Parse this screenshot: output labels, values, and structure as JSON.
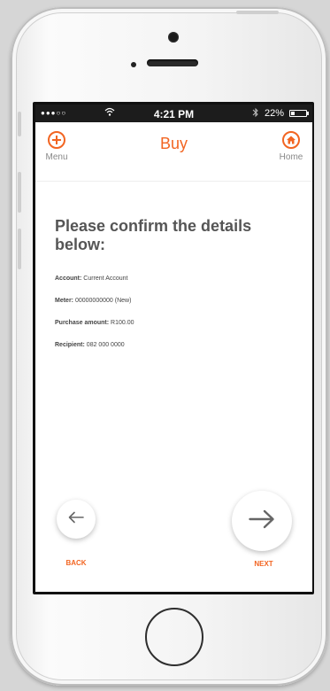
{
  "status_bar": {
    "carrier": "●●●○○",
    "time": "4:21 PM",
    "battery": "22%",
    "battery_level": 0.22
  },
  "nav": {
    "menu_label": "Menu",
    "title": "Buy",
    "home_label": "Home"
  },
  "content": {
    "heading": "Please confirm the details below:",
    "details": [
      {
        "label": "Account:",
        "value": "Current Account"
      },
      {
        "label": "Meter:",
        "value": "00000000000 (New)"
      },
      {
        "label": "Purchase amount:",
        "value": "R100.00"
      },
      {
        "label": "Recipient:",
        "value": "082 000 0000"
      }
    ]
  },
  "actions": {
    "back_label": "BACK",
    "next_label": "NEXT"
  },
  "colors": {
    "accent": "#f26522"
  }
}
